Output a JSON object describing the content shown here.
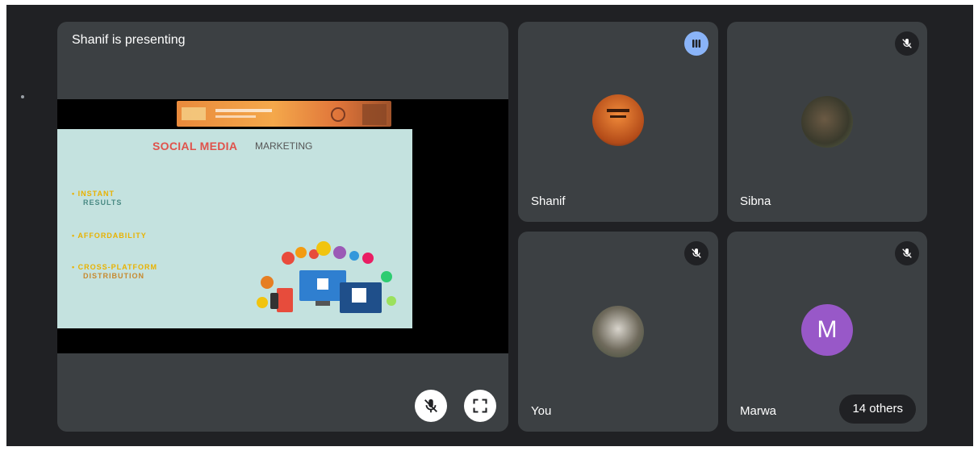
{
  "presentation": {
    "label": "Shanif is presenting",
    "slide": {
      "title_left": "SOCIAL MEDIA",
      "title_right": "MARKETING",
      "bullets": [
        {
          "line1": "• INSTANT",
          "line2": "RESULTS"
        },
        {
          "line1": "• AFFORDABILITY",
          "line2": ""
        },
        {
          "line1": "• CROSS-PLATFORM",
          "line2": "DISTRIBUTION"
        }
      ]
    },
    "controls": {
      "mute_icon": "mic-off-icon",
      "fullscreen_icon": "fullscreen-icon"
    }
  },
  "participants": [
    {
      "name": "Shanif",
      "status": "speaking",
      "avatar": "photo"
    },
    {
      "name": "Sibna",
      "status": "muted",
      "avatar": "photo"
    },
    {
      "name": "You",
      "status": "muted",
      "avatar": "photo"
    },
    {
      "name": "Marwa",
      "status": "muted",
      "avatar": "initial",
      "initial": "M",
      "avatar_color": "#9858c8"
    }
  ],
  "others_count_label": "14 others",
  "colors": {
    "background": "#202124",
    "tile": "#3c4043",
    "speaking": "#8ab4f8",
    "initial_avatar": "#9858c8"
  }
}
